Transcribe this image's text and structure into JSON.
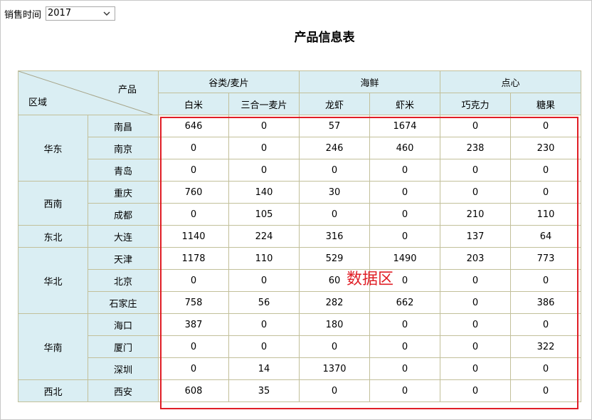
{
  "filter": {
    "label": "销售时间",
    "selected": "2017",
    "icon": "chevron-down-icon"
  },
  "title": "产品信息表",
  "corner": {
    "product": "产品",
    "region": "区域"
  },
  "groups": [
    {
      "label": "谷类/麦片",
      "span": 2
    },
    {
      "label": "海鲜",
      "span": 2
    },
    {
      "label": "点心",
      "span": 2
    }
  ],
  "products": [
    "白米",
    "三合一麦片",
    "龙虾",
    "虾米",
    "巧克力",
    "糖果"
  ],
  "regions": [
    {
      "name": "华东",
      "cities": [
        {
          "name": "南昌",
          "values": [
            "646",
            "0",
            "57",
            "1674",
            "0",
            "0"
          ]
        },
        {
          "name": "南京",
          "values": [
            "0",
            "0",
            "246",
            "460",
            "238",
            "230"
          ]
        },
        {
          "name": "青岛",
          "values": [
            "0",
            "0",
            "0",
            "0",
            "0",
            "0"
          ]
        }
      ]
    },
    {
      "name": "西南",
      "cities": [
        {
          "name": "重庆",
          "values": [
            "760",
            "140",
            "30",
            "0",
            "0",
            "0"
          ]
        },
        {
          "name": "成都",
          "values": [
            "0",
            "105",
            "0",
            "0",
            "210",
            "110"
          ]
        }
      ]
    },
    {
      "name": "东北",
      "cities": [
        {
          "name": "大连",
          "values": [
            "1140",
            "224",
            "316",
            "0",
            "137",
            "64"
          ]
        }
      ]
    },
    {
      "name": "华北",
      "cities": [
        {
          "name": "天津",
          "values": [
            "1178",
            "110",
            "529",
            "1490",
            "203",
            "773"
          ]
        },
        {
          "name": "北京",
          "values": [
            "0",
            "0",
            "60",
            "0",
            "0",
            "0"
          ]
        },
        {
          "name": "石家庄",
          "values": [
            "758",
            "56",
            "282",
            "662",
            "0",
            "386"
          ]
        }
      ]
    },
    {
      "name": "华南",
      "cities": [
        {
          "name": "海口",
          "values": [
            "387",
            "0",
            "180",
            "0",
            "0",
            "0"
          ]
        },
        {
          "name": "厦门",
          "values": [
            "0",
            "0",
            "0",
            "0",
            "0",
            "322"
          ]
        },
        {
          "name": "深圳",
          "values": [
            "0",
            "14",
            "1370",
            "0",
            "0",
            "0"
          ]
        }
      ]
    },
    {
      "name": "西北",
      "cities": [
        {
          "name": "西安",
          "values": [
            "608",
            "35",
            "0",
            "0",
            "0",
            "0"
          ]
        }
      ]
    }
  ],
  "annotation": {
    "label": "数据区",
    "color": "#e01e26"
  },
  "colors": {
    "header_bg": "#daeef3",
    "grid_line": "#c2c09a"
  }
}
